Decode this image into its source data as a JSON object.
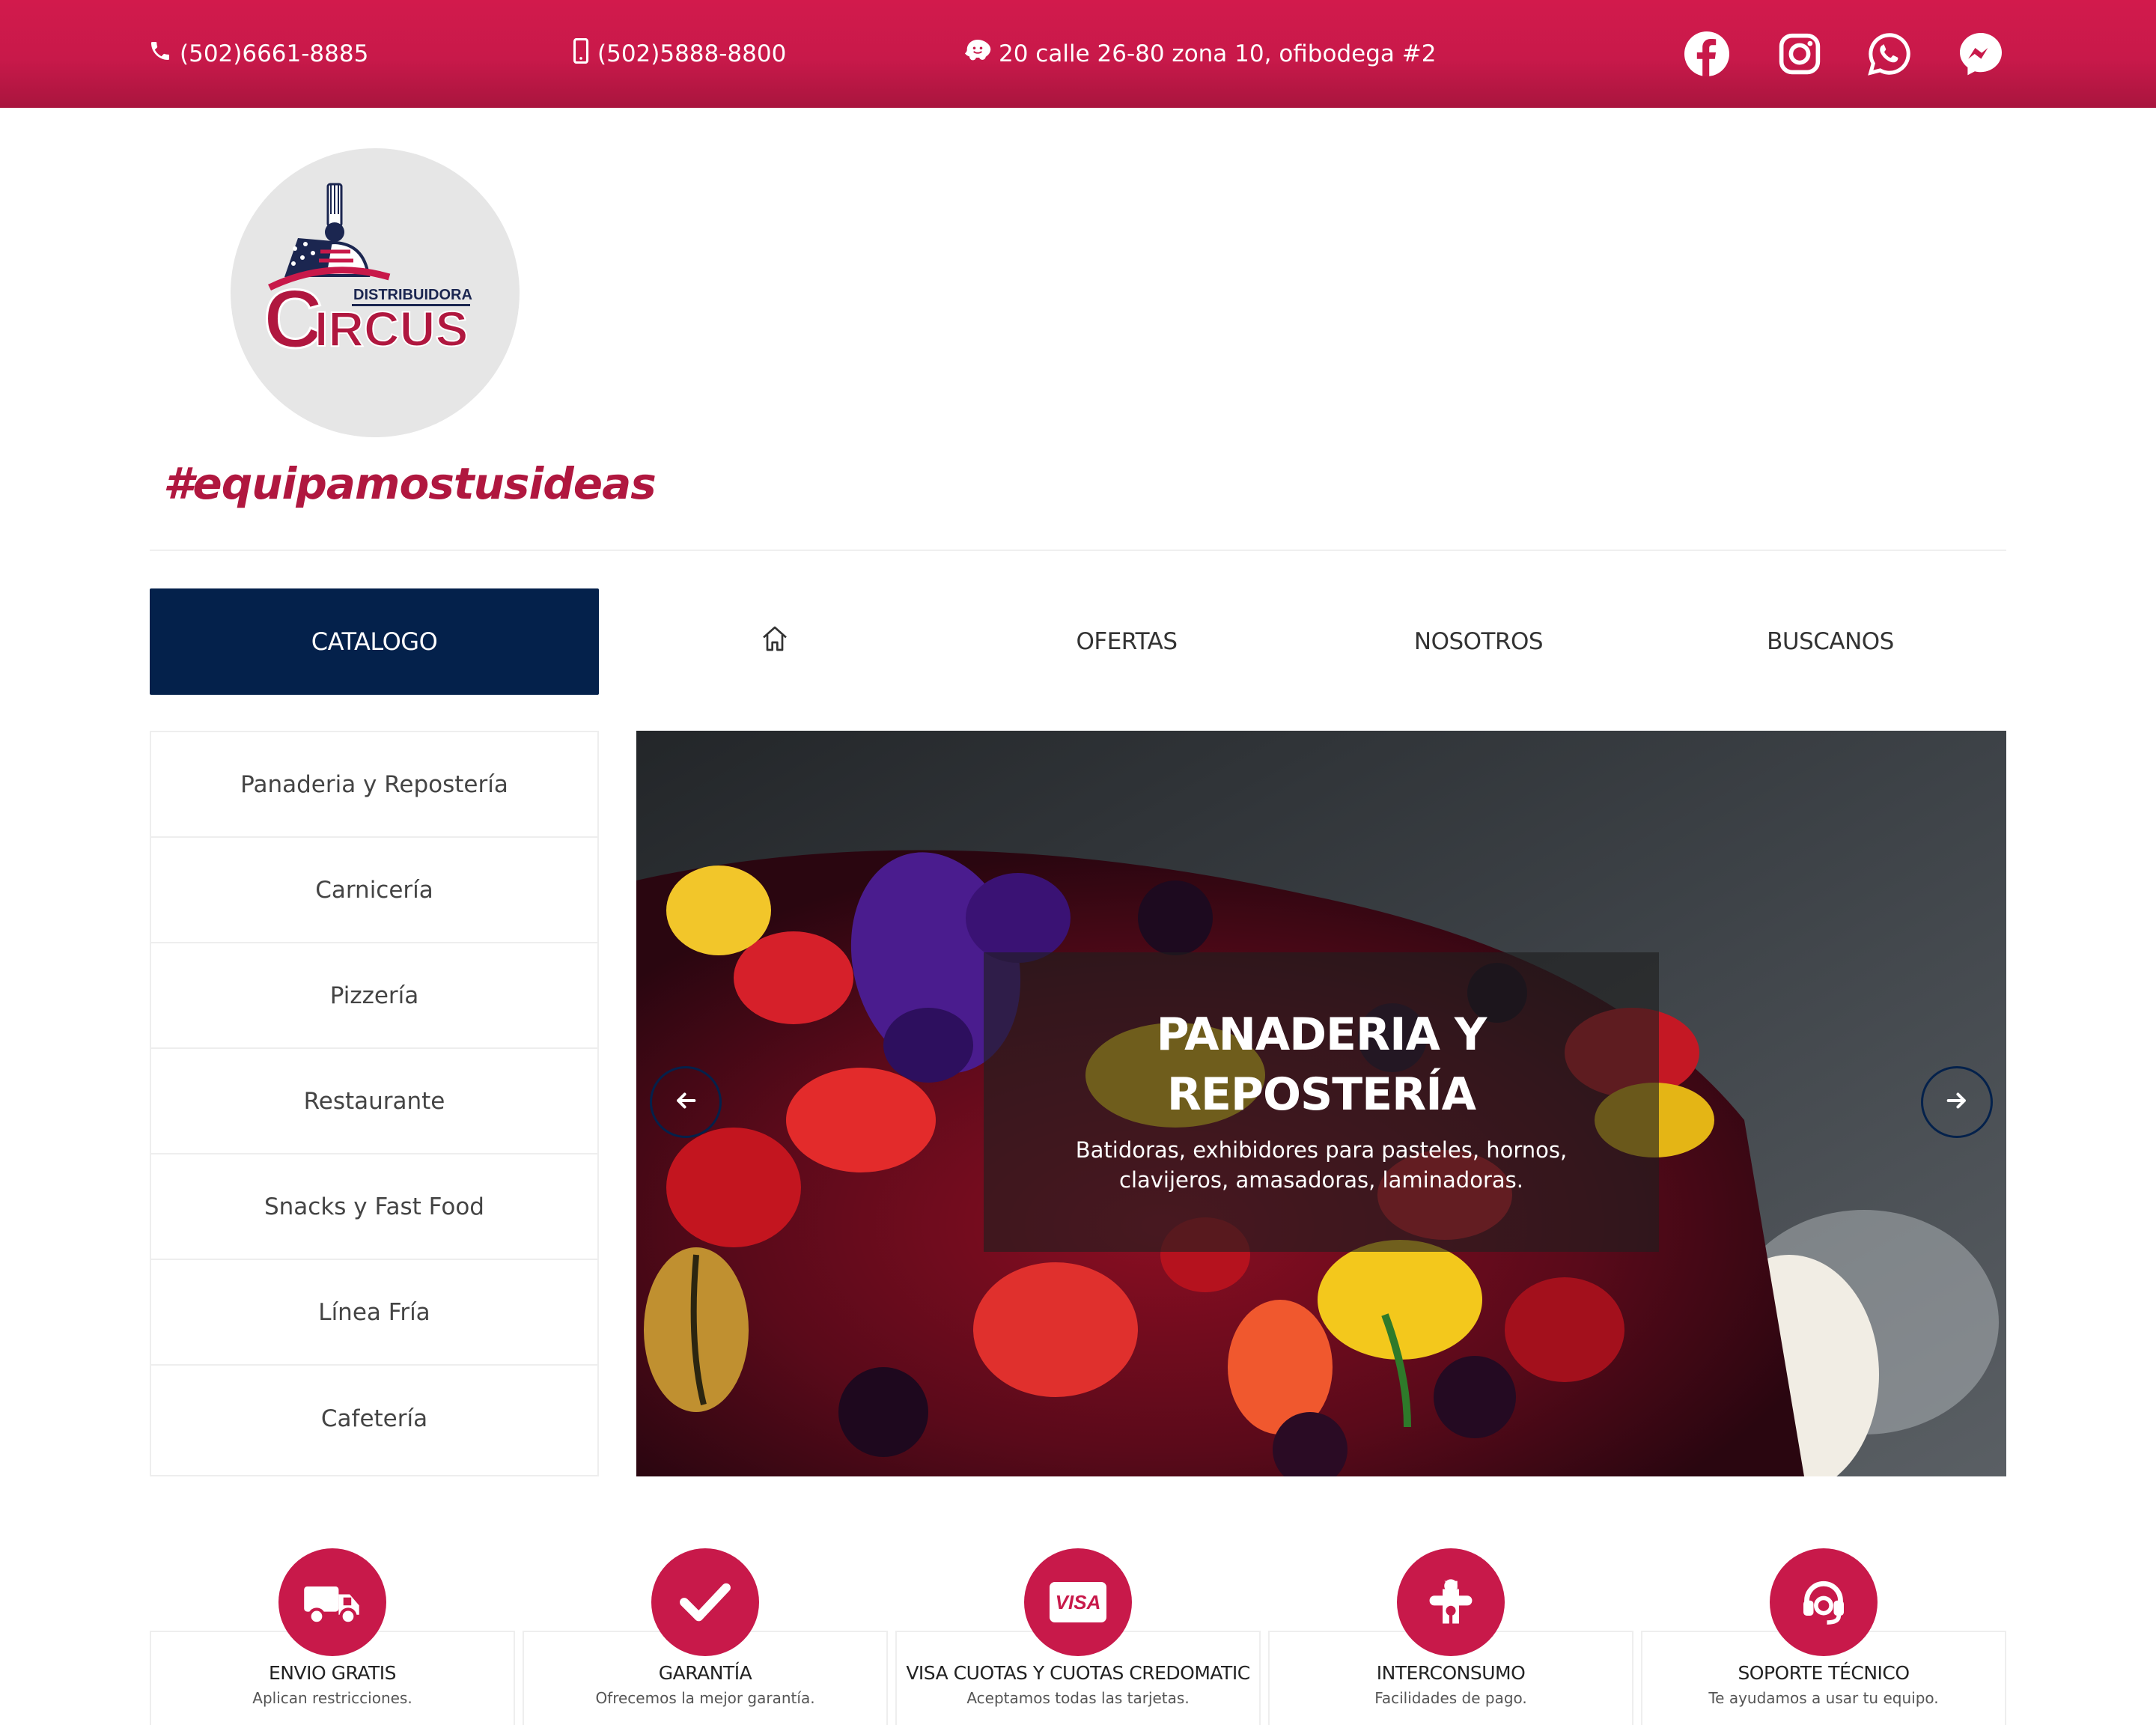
{
  "topbar": {
    "phone": "(502)6661-8885",
    "mobile": "(502)5888-8800",
    "address": "20 calle 26-80 zona 10, ofibodega #2",
    "social": [
      "facebook-icon",
      "instagram-icon",
      "whatsapp-icon",
      "messenger-icon"
    ]
  },
  "brand": {
    "logo_small": "DISTRIBUIDORA",
    "logo_big": "CIRCUS",
    "tagline": "#equipamostusideas"
  },
  "nav": {
    "catalog": "CATALOGO",
    "home_icon": "home-icon",
    "items": [
      "OFERTAS",
      "NOSOTROS",
      "BUSCANOS"
    ]
  },
  "sidebar": {
    "items": [
      {
        "label": "Panaderia y Repostería"
      },
      {
        "label": "Carnicería"
      },
      {
        "label": "Pizzería"
      },
      {
        "label": "Restaurante"
      },
      {
        "label": "Snacks y Fast Food"
      },
      {
        "label": "Línea Fría"
      },
      {
        "label": "Cafetería"
      }
    ]
  },
  "slider": {
    "title_line1": "PANADERIA Y",
    "title_line2": "REPOSTERÍA",
    "text_line1": "Batidoras, exhibidores para pasteles, hornos,",
    "text_line2": "clavijeros, amasadoras, laminadoras.",
    "prev_icon": "arrow-left-icon",
    "next_icon": "arrow-right-icon"
  },
  "features": [
    {
      "icon": "truck-icon",
      "title": "ENVIO GRATIS",
      "subtitle": "Aplican restricciones."
    },
    {
      "icon": "check-icon",
      "title": "GARANTÍA",
      "subtitle": "Ofrecemos la mejor garantía."
    },
    {
      "icon": "visa-card-icon",
      "title": "VISA CUOTAS Y CUOTAS CREDOMATIC",
      "subtitle": "Aceptamos todas las tarjetas.",
      "badge": "VISA"
    },
    {
      "icon": "puzzle-icon",
      "title": "INTERCONSUMO",
      "subtitle": "Facilidades de pago."
    },
    {
      "icon": "headset-icon",
      "title": "SOPORTE TÉCNICO",
      "subtitle": "Te ayudamos a usar tu equipo."
    }
  ],
  "colors": {
    "brand_red": "#c8194a",
    "navy": "#04214b",
    "tagline": "#b0173f"
  }
}
